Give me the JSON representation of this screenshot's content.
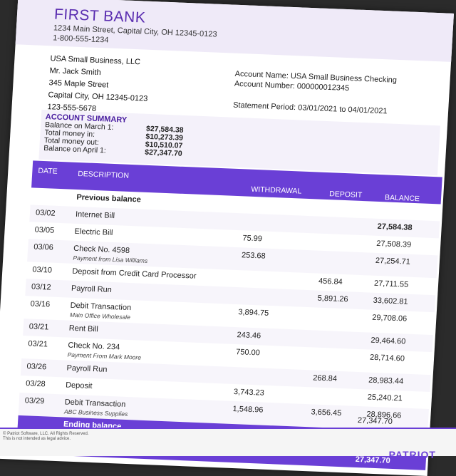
{
  "bank": {
    "name": "FIRST BANK",
    "address": "1234 Main Street, Capital City, OH 12345-0123",
    "phone": "1-800-555-1234"
  },
  "customer": {
    "line1": "USA Small Business, LLC",
    "line2": "Mr. Jack Smith",
    "line3": "345 Maple Street",
    "line4": "Capital City, OH 12345-0123",
    "line5": "123-555-5678"
  },
  "account": {
    "name": "Account Name: USA Small Business Checking",
    "number": "Account Number: 000000012345",
    "period": "Statement Period: 03/01/2021 to 04/01/2021"
  },
  "summary": {
    "title": "ACCOUNT SUMMARY",
    "rows": [
      {
        "label": "Balance on March 1:",
        "value": "$27,584.38"
      },
      {
        "label": "Total money in:",
        "value": "$10,273.39"
      },
      {
        "label": "Total money out:",
        "value": "$10,510.07"
      },
      {
        "label": "Balance on April 1:",
        "value": "$27,347.70"
      }
    ]
  },
  "table": {
    "headers": {
      "date": "DATE",
      "description": "DESCRIPTION",
      "withdrawal": "WITHDRAWAL",
      "deposit": "DEPOSIT",
      "balance": "BALANCE"
    },
    "rows": [
      {
        "date": "",
        "desc": "Previous balance",
        "sub": "",
        "w": "",
        "d": "",
        "b": ""
      },
      {
        "date": "03/02",
        "desc": "Internet Bill",
        "sub": "",
        "w": "",
        "d": "",
        "b": "27,584.38"
      },
      {
        "date": "03/05",
        "desc": "Electric Bill",
        "sub": "",
        "w": "75.99",
        "d": "",
        "b": "27,508.39"
      },
      {
        "date": "03/06",
        "desc": "Check No. 4598",
        "sub": "Payment from Lisa Williams",
        "w": "253.68",
        "d": "",
        "b": "27,254.71"
      },
      {
        "date": "03/10",
        "desc": "Deposit from Credit Card Processor",
        "sub": "",
        "w": "",
        "d": "456.84",
        "b": "27,711.55"
      },
      {
        "date": "03/12",
        "desc": "Payroll Run",
        "sub": "",
        "w": "",
        "d": "5,891.26",
        "b": "33,602.81"
      },
      {
        "date": "03/16",
        "desc": "Debit Transaction",
        "sub": "Main Office Wholesale",
        "w": "3,894.75",
        "d": "",
        "b": "29,708.06"
      },
      {
        "date": "03/21",
        "desc": "Rent Bill",
        "sub": "",
        "w": "243.46",
        "d": "",
        "b": "29,464.60"
      },
      {
        "date": "03/21",
        "desc": "Check No. 234",
        "sub": "Payment From Mark Moore",
        "w": "750.00",
        "d": "",
        "b": "28,714.60"
      },
      {
        "date": "03/26",
        "desc": "Payroll Run",
        "sub": "",
        "w": "",
        "d": "268.84",
        "b": "28,983.44"
      },
      {
        "date": "03/28",
        "desc": "Deposit",
        "sub": "",
        "w": "3,743.23",
        "d": "",
        "b": "25,240.21"
      },
      {
        "date": "03/29",
        "desc": "Debit Transaction",
        "sub": "ABC Business Supplies",
        "w": "1,548.96",
        "d": "3,656.45",
        "b": "28,896.66"
      }
    ],
    "ending_label": "Ending balance",
    "ending_value": "27,347.70",
    "final_value": "27,347.70"
  },
  "footer": {
    "copyright": "© Patriot Software, LLC. All Rights Reserved.",
    "disclaimer": "This is not intended as legal advice.",
    "logo": "PATRIOT"
  },
  "colors": {
    "accent": "#6a3fd6",
    "title": "#5a2db0"
  }
}
